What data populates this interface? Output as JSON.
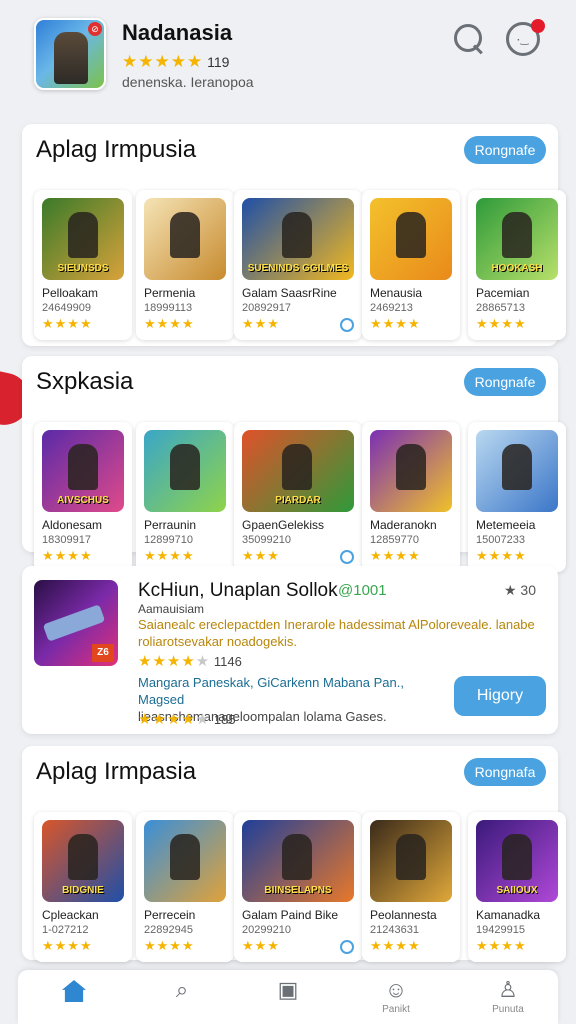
{
  "header": {
    "app_title": "Nadanasia",
    "rating_stars": "★★★★★",
    "rating_count": "119",
    "developer": "denenska. Ieranopoa",
    "icon_badge": "⊘"
  },
  "sections": [
    {
      "title": "Aplag Irmpusia",
      "button": "Rongnafe",
      "cards": [
        {
          "name": "Pelloakam",
          "downloads": "24649909",
          "stars": "★★★★",
          "thumb_label": "SIEUNSDS",
          "c1": "#3a7a2a",
          "c2": "#d8a23a"
        },
        {
          "name": "Permenia",
          "downloads": "18999113",
          "stars": "★★★★",
          "thumb_label": "",
          "c1": "#f5e3b5",
          "c2": "#c78b2f"
        },
        {
          "name": "Galam SaasrRine",
          "downloads": "20892917",
          "stars": "★★★",
          "thumb_label": "SUENINDS GGILMES",
          "c1": "#1f4fa8",
          "c2": "#f2b81e"
        },
        {
          "name": "Menausia",
          "downloads": "2469213",
          "stars": "★★★★",
          "thumb_label": "",
          "c1": "#f3c12c",
          "c2": "#e98a1a"
        },
        {
          "name": "Pacemian",
          "downloads": "28865713",
          "stars": "★★★★",
          "thumb_label": "HOOKASH",
          "c1": "#2e9a3a",
          "c2": "#b8e06a"
        }
      ]
    },
    {
      "title": "Sxpkasia",
      "button": "Rongnafe",
      "cards": [
        {
          "name": "Aldonesam",
          "downloads": "18309917",
          "stars": "★★★★",
          "thumb_label": "AIVSCHUS",
          "c1": "#5a2aa8",
          "c2": "#e04a8a"
        },
        {
          "name": "Perraunin",
          "downloads": "12899710",
          "stars": "★★★★",
          "thumb_label": "",
          "c1": "#3aa6c8",
          "c2": "#8fd34a"
        },
        {
          "name": "GpaenGelekiss",
          "downloads": "35099210",
          "stars": "★★★",
          "thumb_label": "PIARDAR",
          "c1": "#e0512a",
          "c2": "#2f9a3a"
        },
        {
          "name": "Maderanokn",
          "downloads": "12859770",
          "stars": "★★★★",
          "thumb_label": "",
          "c1": "#7b2fb5",
          "c2": "#f0c12a"
        },
        {
          "name": "Metemeeia",
          "downloads": "15007233",
          "stars": "★★★★",
          "thumb_label": "",
          "c1": "#b9d8f0",
          "c2": "#3b76c8"
        }
      ]
    },
    {
      "title": "Aplag Irmpasia",
      "button": "Rongnafa",
      "cards": [
        {
          "name": "Cpleackan",
          "downloads": "1-027212",
          "stars": "★★★★",
          "thumb_label": "BIDGNIE",
          "c1": "#d8562a",
          "c2": "#1f4fa8"
        },
        {
          "name": "Perrecein",
          "downloads": "22892945",
          "stars": "★★★★",
          "thumb_label": "",
          "c1": "#3a8fd8",
          "c2": "#e0a23a"
        },
        {
          "name": "Galam Paind Bike",
          "downloads": "20299210",
          "stars": "★★★",
          "thumb_label": "BIINSELAPNS",
          "c1": "#1f3f9a",
          "c2": "#e8782a"
        },
        {
          "name": "Peolannesta",
          "downloads": "21243631",
          "stars": "★★★★",
          "thumb_label": "",
          "c1": "#3a2a1a",
          "c2": "#e0a83a"
        },
        {
          "name": "Kamanadka",
          "downloads": "19429915",
          "stars": "★★★★",
          "thumb_label": "SAIIOUX",
          "c1": "#3a1a7a",
          "c2": "#b048d8"
        }
      ]
    }
  ],
  "featured": {
    "title": "KcHiun, Unaplan Sollok",
    "tag": "@1001",
    "score": "★ 30",
    "subtitle": "Aamauisiam",
    "description": "Saianealc ereclepactden Inerarole hadessimat AlPoloreveale. lanabe roliarotsevakar noadogekis.",
    "rating1_count": "1146",
    "line2": "Mangara Paneskak, GiCarkenn Mabana Pan., Magsed",
    "line2_sub": "lieasnshemanageloompalan lolama Gases.",
    "rating2_count": "185",
    "button": "Higory",
    "thumb_corner": "Z6"
  },
  "bottom_nav": [
    {
      "label": "",
      "icon": "home-icon"
    },
    {
      "label": "",
      "icon": "search-icon"
    },
    {
      "label": "",
      "icon": "apps-icon"
    },
    {
      "label": "Panikt",
      "icon": "face-icon"
    },
    {
      "label": "Punuta",
      "icon": "person-icon"
    }
  ],
  "colors": {
    "accent": "#4aa3e0",
    "star": "#f5b400",
    "active_nav": "#2f86d1"
  }
}
